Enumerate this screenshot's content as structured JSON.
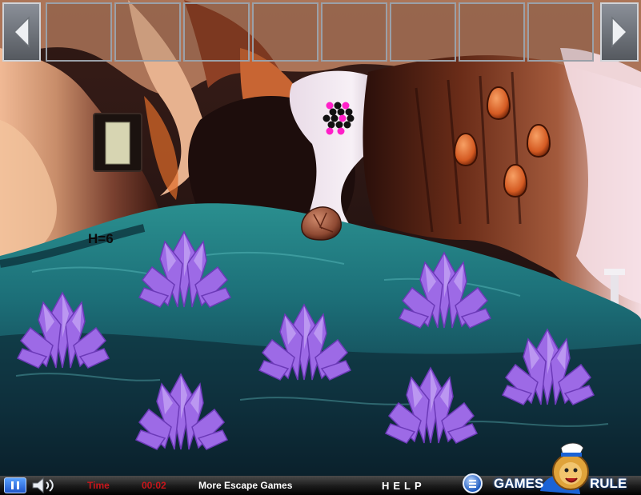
{
  "scene": {
    "clue_text": "H=6"
  },
  "inventory": {
    "slot_count": 8
  },
  "bottom_bar": {
    "time_label": "Time",
    "time_value": "00:02",
    "more_games_label": "More Escape Games",
    "help_label": "HELP",
    "pause_icon": "pause-icon",
    "sound_icon": "speaker-icon",
    "menu_icon": "menu-icon"
  },
  "logo": {
    "left_text": "GAMES",
    "right_text": "RULE"
  },
  "colors": {
    "crystal": "#9d6ae6",
    "water": "#1f7e84",
    "egg": "#d45a22",
    "dot_magenta": "#ff1fc8",
    "time_red": "#c8161b"
  }
}
